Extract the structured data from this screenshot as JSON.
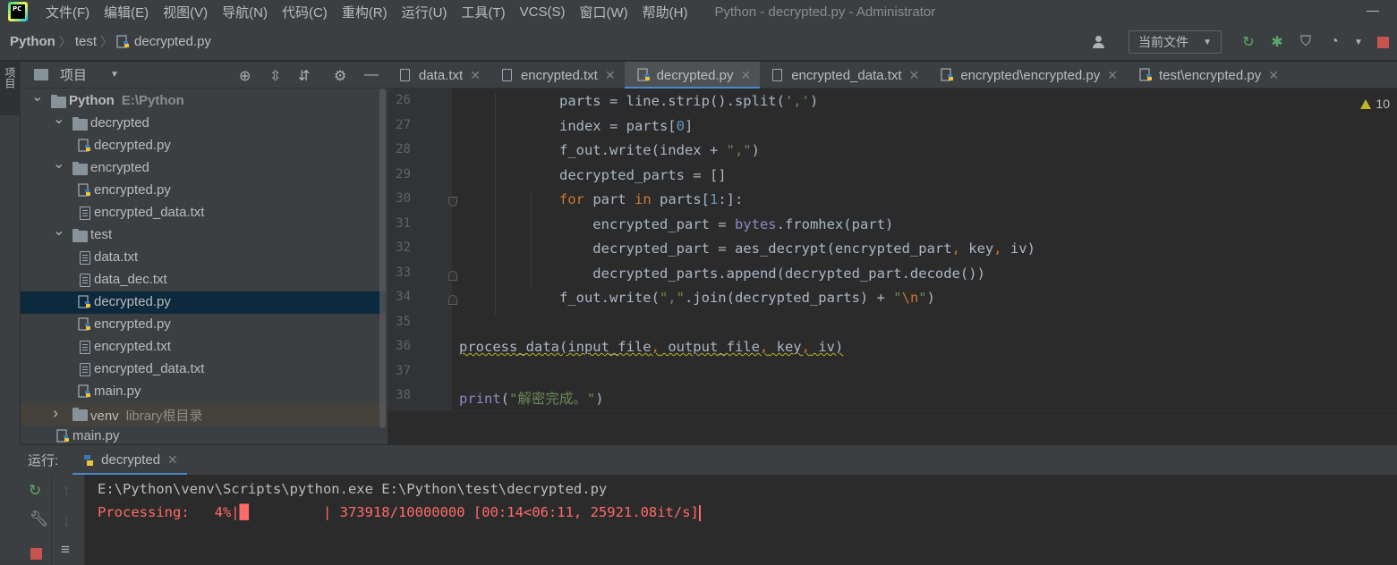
{
  "menubar": {
    "items": [
      "文件(F)",
      "编辑(E)",
      "视图(V)",
      "导航(N)",
      "代码(C)",
      "重构(R)",
      "运行(U)",
      "工具(T)",
      "VCS(S)",
      "窗口(W)",
      "帮助(H)"
    ],
    "window_title": "Python - decrypted.py - Administrator"
  },
  "navbar": {
    "breadcrumbs": [
      "Python",
      "test",
      "decrypted.py"
    ],
    "run_config": "当前文件"
  },
  "left_stripe": {
    "project_label": "项目"
  },
  "project_panel": {
    "title": "项目",
    "tree": [
      {
        "label": "Python",
        "hint": "E:\\Python",
        "kind": "folder",
        "depth": 0,
        "expanded": true
      },
      {
        "label": "decrypted",
        "kind": "folder",
        "depth": 1,
        "expanded": true
      },
      {
        "label": "decrypted.py",
        "kind": "py",
        "depth": 2
      },
      {
        "label": "encrypted",
        "kind": "folder",
        "depth": 1,
        "expanded": true
      },
      {
        "label": "encrypted.py",
        "kind": "py",
        "depth": 2
      },
      {
        "label": "encrypted_data.txt",
        "kind": "txt",
        "depth": 2
      },
      {
        "label": "test",
        "kind": "folder",
        "depth": 1,
        "expanded": true
      },
      {
        "label": "data.txt",
        "kind": "txt",
        "depth": 2
      },
      {
        "label": "data_dec.txt",
        "kind": "txt",
        "depth": 2
      },
      {
        "label": "decrypted.py",
        "kind": "py",
        "depth": 2,
        "selected": true
      },
      {
        "label": "encrypted.py",
        "kind": "py",
        "depth": 2
      },
      {
        "label": "encrypted.txt",
        "kind": "txt",
        "depth": 2
      },
      {
        "label": "encrypted_data.txt",
        "kind": "txt",
        "depth": 2
      },
      {
        "label": "main.py",
        "kind": "py",
        "depth": 2
      },
      {
        "label": "venv",
        "hint": "library根目录",
        "kind": "folder",
        "depth": 1,
        "expanded": false,
        "excluded": true
      },
      {
        "label": "main.py",
        "kind": "py",
        "depth": 1
      }
    ]
  },
  "editor_tabs": [
    {
      "label": "data.txt",
      "kind": "txt"
    },
    {
      "label": "encrypted.txt",
      "kind": "txt"
    },
    {
      "label": "decrypted.py",
      "kind": "py",
      "active": true
    },
    {
      "label": "encrypted_data.txt",
      "kind": "txt"
    },
    {
      "label": "encrypted\\encrypted.py",
      "kind": "py"
    },
    {
      "label": "test\\encrypted.py",
      "kind": "py"
    }
  ],
  "editor": {
    "warning_count": "10",
    "line_numbers": [
      "26",
      "27",
      "28",
      "29",
      "30",
      "31",
      "32",
      "33",
      "34",
      "35",
      "36",
      "37",
      "38"
    ],
    "code": [
      "            parts = line.strip().split(',')",
      "            index = parts[0]",
      "            f_out.write(index + \",\")",
      "            decrypted_parts = []",
      "            for part in parts[1:]:",
      "                encrypted_part = bytes.fromhex(part)",
      "                decrypted_part = aes_decrypt(encrypted_part, key, iv)",
      "                decrypted_parts.append(decrypted_part.decode())",
      "            f_out.write(\",\".join(decrypted_parts) + \"\\n\")",
      "",
      "process_data(input_file, output_file, key, iv)",
      "",
      "print(\"解密完成。\")"
    ]
  },
  "run_panel": {
    "label": "运行:",
    "tab": "decrypted",
    "console": [
      "E:\\Python\\venv\\Scripts\\python.exe E:\\Python\\test\\decrypted.py",
      "Processing:   4%|█▏        | 373918/10000000 [00:14<06:11, 25921.08it/s]"
    ],
    "progress_fraction": 0.04
  },
  "colors": {
    "keyword": "#cc7832",
    "string": "#6a8759",
    "number": "#6897bb",
    "builtin": "#8888c6",
    "error_text": "#ff6b68",
    "accent": "#4a88c7"
  }
}
